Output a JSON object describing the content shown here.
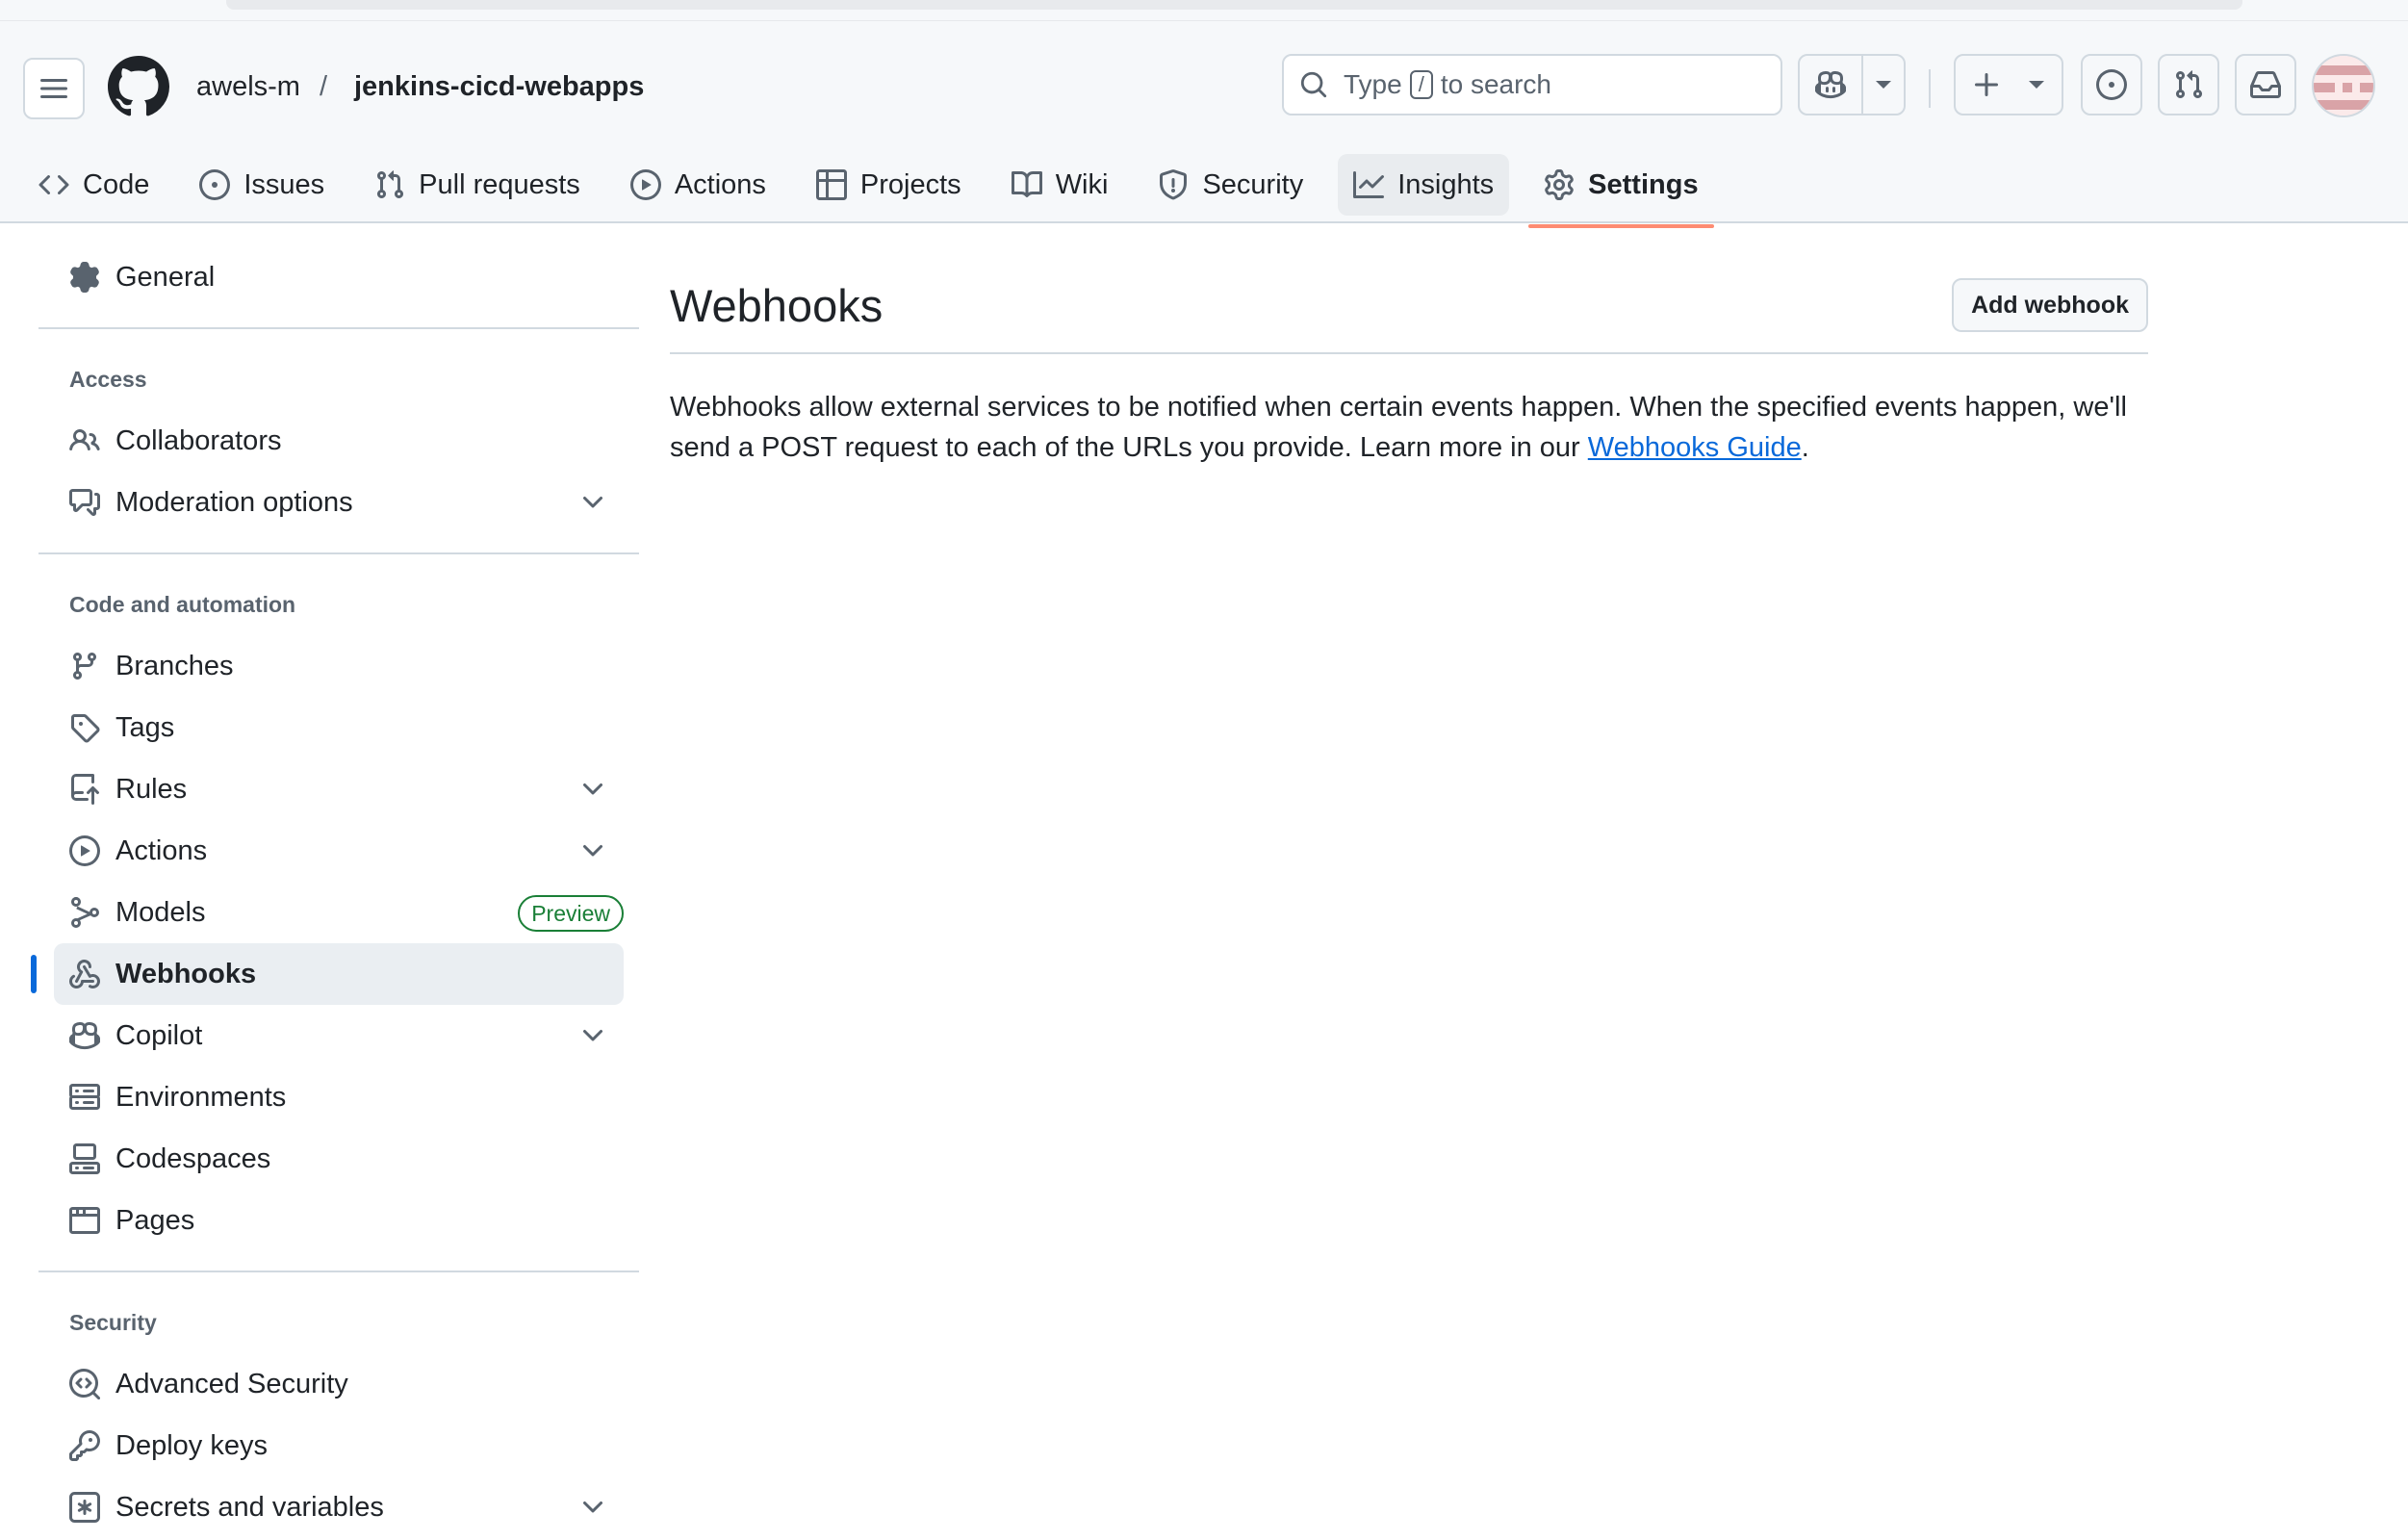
{
  "header": {
    "owner": "awels-m",
    "separator": "/",
    "repo": "jenkins-cicd-webapps",
    "search": {
      "prefix": "Type",
      "key": "/",
      "suffix": "to search"
    }
  },
  "tabs": [
    {
      "label": "Code",
      "icon": "code-icon"
    },
    {
      "label": "Issues",
      "icon": "issue-icon"
    },
    {
      "label": "Pull requests",
      "icon": "pull-request-icon"
    },
    {
      "label": "Actions",
      "icon": "play-icon"
    },
    {
      "label": "Projects",
      "icon": "table-icon"
    },
    {
      "label": "Wiki",
      "icon": "book-icon"
    },
    {
      "label": "Security",
      "icon": "shield-icon"
    },
    {
      "label": "Insights",
      "icon": "graph-icon"
    },
    {
      "label": "Settings",
      "icon": "gear-icon",
      "selected": true
    }
  ],
  "sidebar": {
    "general": "General",
    "access_heading": "Access",
    "collaborators": "Collaborators",
    "moderation": "Moderation options",
    "code_heading": "Code and automation",
    "branches": "Branches",
    "tags": "Tags",
    "rules": "Rules",
    "actions": "Actions",
    "models": "Models",
    "models_badge": "Preview",
    "webhooks": "Webhooks",
    "copilot": "Copilot",
    "environments": "Environments",
    "codespaces": "Codespaces",
    "pages": "Pages",
    "security_heading": "Security",
    "advanced_security": "Advanced Security",
    "deploy_keys": "Deploy keys",
    "secrets": "Secrets and variables"
  },
  "main": {
    "title": "Webhooks",
    "add_button": "Add webhook",
    "description_pre": "Webhooks allow external services to be notified when certain events happen. When the specified events happen, we'll send a POST request to each of the URLs you provide. Learn more in our ",
    "guide_link": "Webhooks Guide",
    "description_post": "."
  },
  "colors": {
    "accent": "#0969da",
    "selected_underline": "#fd8c73",
    "badge_green": "#1a7f37"
  }
}
